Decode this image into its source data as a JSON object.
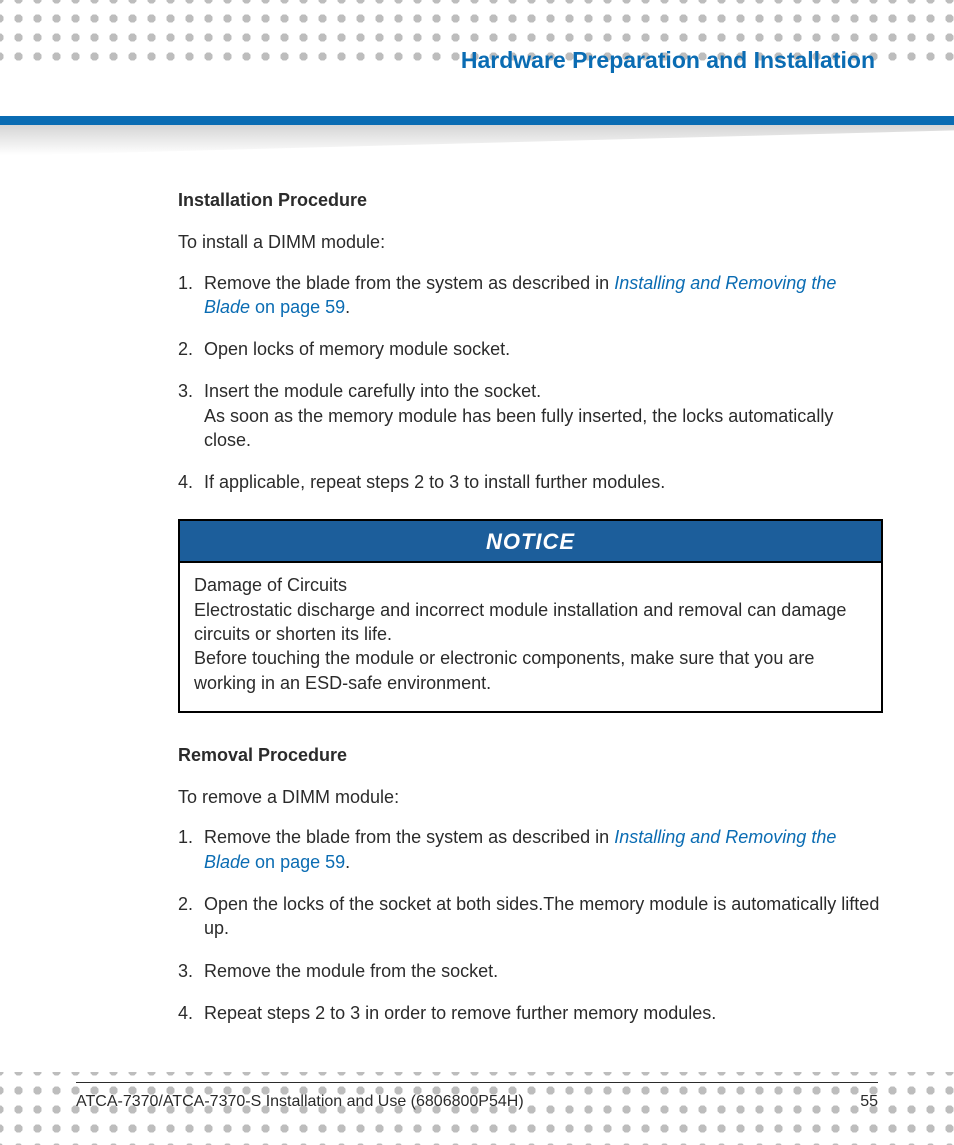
{
  "header": {
    "chapter_title": "Hardware Preparation and Installation"
  },
  "install": {
    "heading": "Installation Procedure",
    "intro": "To install a DIMM module:",
    "steps": [
      {
        "pre": "Remove the blade from the system as described in ",
        "link_em": "Installing and Removing the Blade",
        "link_tail": " on page 59",
        "post": "."
      },
      {
        "text": "Open locks of memory module socket."
      },
      {
        "text": "Insert the module carefully into the socket.",
        "sub": "As soon as the memory module has been fully inserted, the locks automatically close."
      },
      {
        "text": "If applicable, repeat steps 2 to 3 to install further modules."
      }
    ]
  },
  "notice": {
    "label": "NOTICE",
    "line1": "Damage of Circuits",
    "line2": "Electrostatic discharge and incorrect module installation and removal can damage circuits or shorten its life.",
    "line3": "Before touching the module or electronic components, make sure that you are working in an ESD-safe environment."
  },
  "removal": {
    "heading": "Removal Procedure",
    "intro": "To remove a DIMM module:",
    "steps": [
      {
        "pre": "Remove the blade from the system as described in ",
        "link_em": "Installing and Removing the Blade",
        "link_tail": " on page 59",
        "post": "."
      },
      {
        "text": "Open the locks of the socket at both sides.The memory module is automatically lifted up."
      },
      {
        "text": "Remove the module from the socket."
      },
      {
        "text": "Repeat steps 2 to 3 in order to remove further memory modules."
      }
    ]
  },
  "footer": {
    "doc": "ATCA-7370/ATCA-7370-S Installation and Use (6806800P54H)",
    "page": "55"
  }
}
